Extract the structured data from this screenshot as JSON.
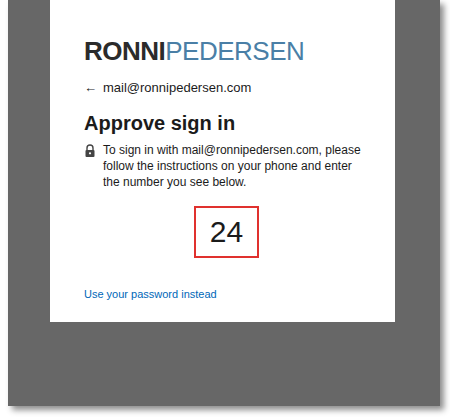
{
  "logo": {
    "primary": "RONNI",
    "secondary": "PEDERSEN"
  },
  "account": {
    "back": "←",
    "email": "mail@ronnipedersen.com"
  },
  "title": "Approve sign in",
  "message": "To sign in with mail@ronnipedersen.com, please follow the instructions on your phone and enter the number you see below.",
  "number": "24",
  "link": "Use your password instead"
}
